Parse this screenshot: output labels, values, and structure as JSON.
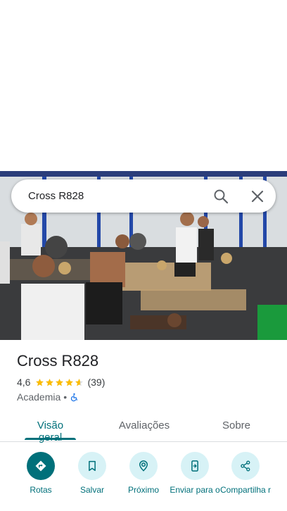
{
  "search": {
    "query": "Cross R828"
  },
  "place": {
    "name": "Cross R828",
    "rating": "4,6",
    "rating_value": 4.6,
    "review_count": "(39)",
    "category": "Academia",
    "separator": "•"
  },
  "tabs": [
    {
      "label": "Visão geral",
      "active": true
    },
    {
      "label": "Avaliações",
      "active": false
    },
    {
      "label": "Sobre",
      "active": false
    }
  ],
  "actions": [
    {
      "label": "Rotas",
      "icon": "directions-icon"
    },
    {
      "label": "Salvar",
      "icon": "bookmark-icon"
    },
    {
      "label": "Próximo",
      "icon": "nearby-icon"
    },
    {
      "label": "Enviar para o",
      "icon": "send-to-phone-icon"
    },
    {
      "label": "Compartilha r",
      "icon": "share-icon"
    }
  ],
  "colors": {
    "accent": "#00707a",
    "star": "#fbbc04",
    "action_bg": "#d7f2f6"
  }
}
